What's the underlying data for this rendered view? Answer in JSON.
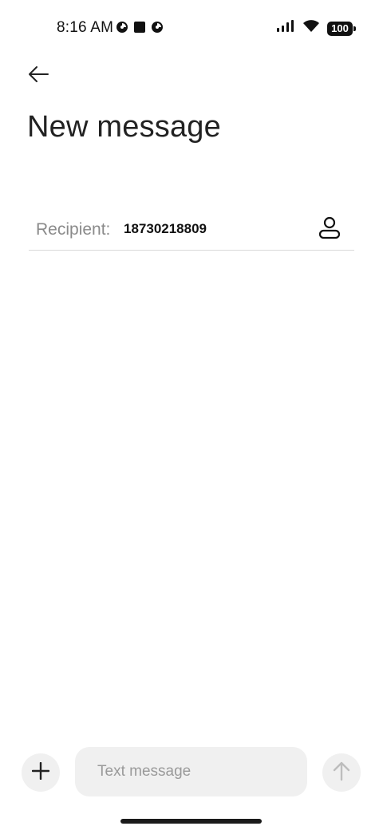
{
  "status_bar": {
    "time": "8:16 AM",
    "battery": "100",
    "left_icons": [
      "notification-app-icon",
      "square-notification-icon",
      "notification-app-icon"
    ],
    "right_icons": [
      "signal-icon",
      "wifi-icon",
      "battery-icon"
    ]
  },
  "header": {
    "back_icon": "arrow-left-icon",
    "title": "New message"
  },
  "recipient": {
    "label": "Recipient:",
    "value": "18730218809",
    "contact_icon": "person-icon"
  },
  "composer": {
    "attach_icon": "plus-icon",
    "placeholder": "Text message",
    "send_icon": "arrow-up-icon"
  },
  "colors": {
    "background": "#ffffff",
    "muted_text": "#8a8a8a",
    "input_bg": "#f0f0f0",
    "divider": "#d9d9d9"
  }
}
